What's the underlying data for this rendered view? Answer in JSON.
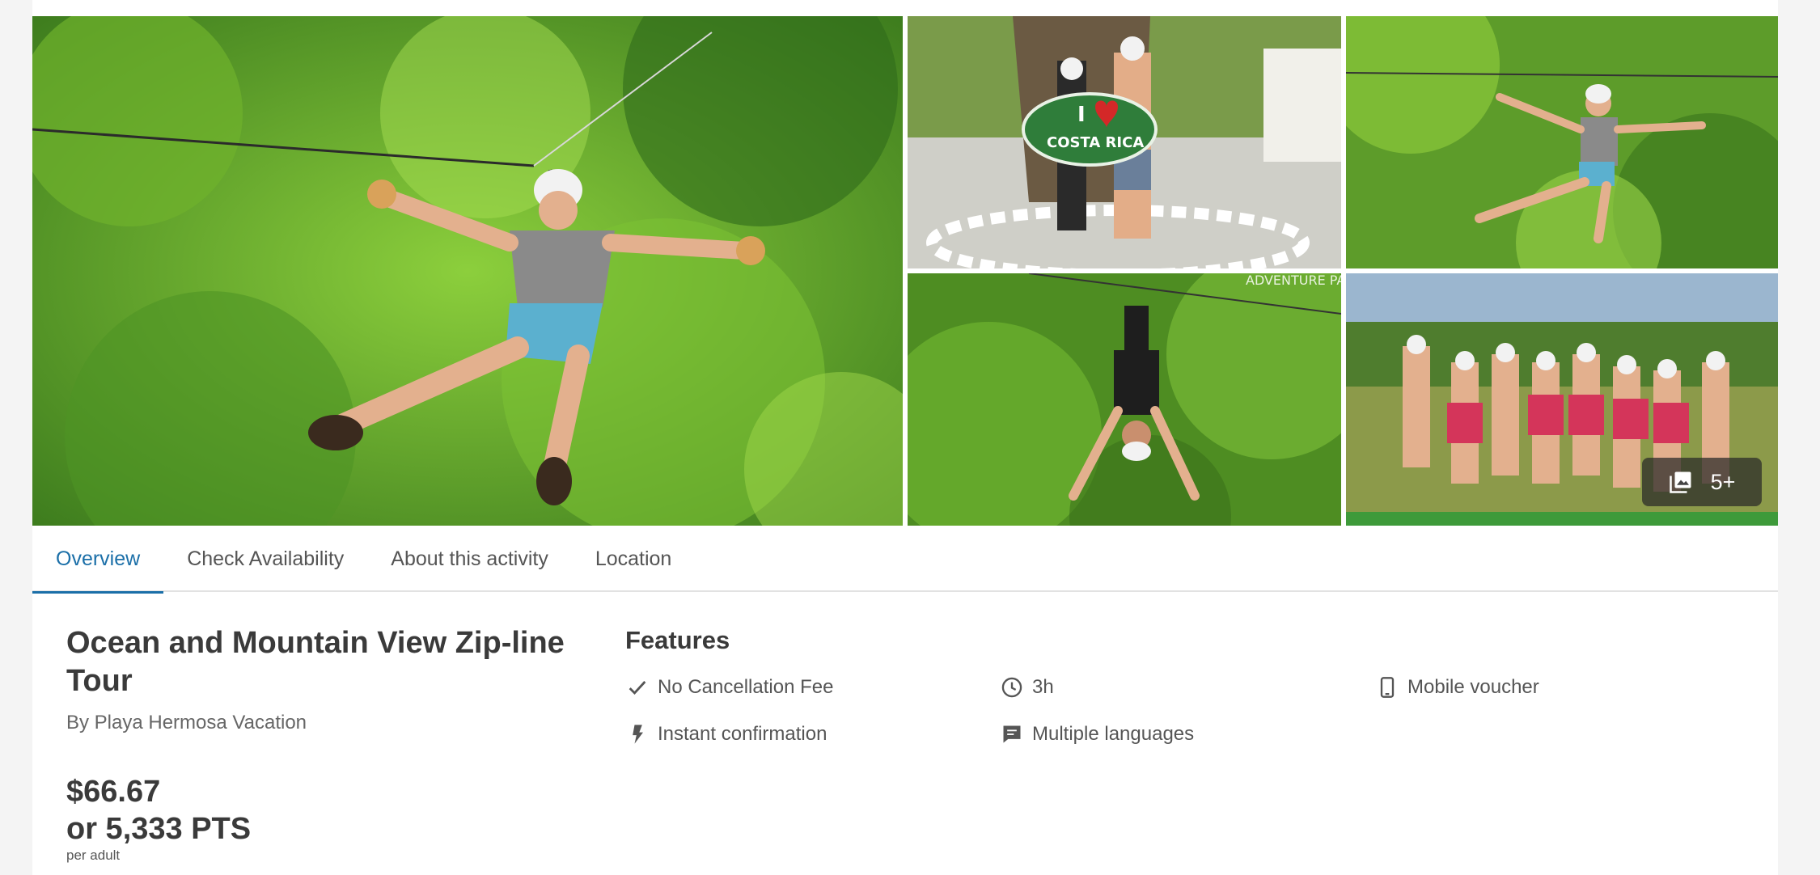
{
  "gallery": {
    "more_label": "5+",
    "sign_text_1": "I",
    "sign_text_2": "COSTA RICA",
    "watermark": "ADVENTURE PARK"
  },
  "tabs": [
    {
      "label": "Overview",
      "active": true
    },
    {
      "label": "Check Availability",
      "active": false
    },
    {
      "label": "About this activity",
      "active": false
    },
    {
      "label": "Location",
      "active": false
    }
  ],
  "activity": {
    "title": "Ocean and Mountain View Zip-line Tour",
    "provider": "By Playa Hermosa Vacation",
    "price": "$66.67",
    "points": "or 5,333 PTS",
    "price_unit": "per adult"
  },
  "features": {
    "heading": "Features",
    "items": [
      {
        "icon": "checkmark-icon",
        "label": "No Cancellation Fee"
      },
      {
        "icon": "clock-icon",
        "label": "3h"
      },
      {
        "icon": "mobile-phone-icon",
        "label": "Mobile voucher"
      },
      {
        "icon": "lightning-icon",
        "label": "Instant confirmation"
      },
      {
        "icon": "chat-bubble-icon",
        "label": "Multiple languages"
      }
    ]
  },
  "colors": {
    "accent": "#1b6fa8",
    "text": "#3a3a3a",
    "foliage": "#5a9b2a"
  }
}
